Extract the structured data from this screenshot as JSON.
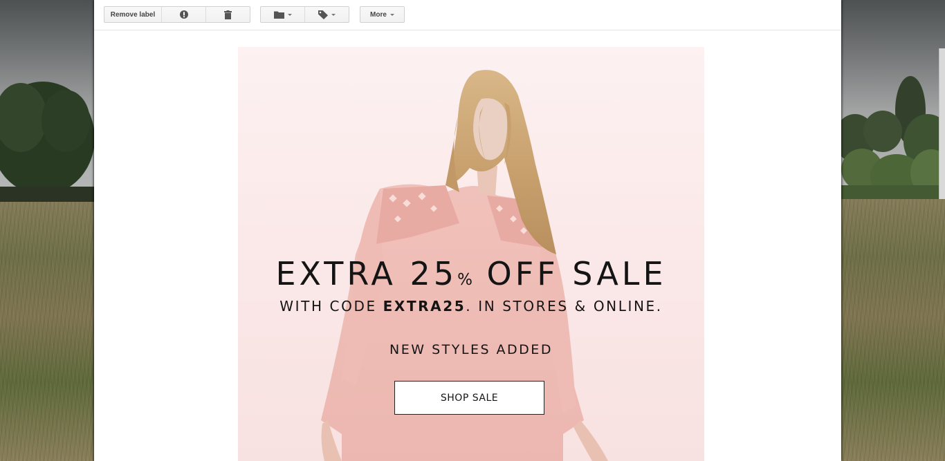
{
  "toolbar": {
    "remove_label": "Remove label",
    "more_label": "More",
    "icons": {
      "spam": "report-spam-icon",
      "delete": "trash-icon",
      "move": "folder-icon",
      "labels": "label-tag-icon"
    }
  },
  "email": {
    "headline_main": "EXTRA 25",
    "headline_pct": "%",
    "headline_rest": " OFF SALE",
    "subline_prefix": "WITH CODE ",
    "subline_code": "EXTRA25",
    "subline_suffix": ". IN STORES & ONLINE.",
    "new_styles": "NEW STYLES ADDED",
    "cta_label": "SHOP SALE"
  },
  "colors": {
    "banner_bg": "#fbe9e9",
    "dress": "#f1bfb8",
    "text": "#141414"
  }
}
